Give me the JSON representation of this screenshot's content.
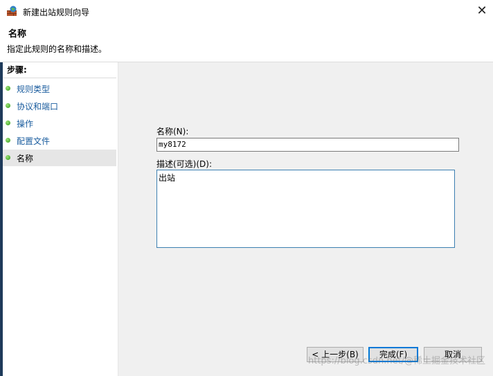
{
  "window": {
    "title": "新建出站规则向导",
    "close_glyph": "✕"
  },
  "header": {
    "title": "名称",
    "subtitle": "指定此规则的名称和描述。"
  },
  "sidebar": {
    "heading": "步骤:",
    "items": [
      {
        "label": "规则类型",
        "active": false
      },
      {
        "label": "协议和端口",
        "active": false
      },
      {
        "label": "操作",
        "active": false
      },
      {
        "label": "配置文件",
        "active": false
      },
      {
        "label": "名称",
        "active": true
      }
    ]
  },
  "form": {
    "name_label": "名称(N):",
    "name_value": "my8172",
    "desc_label": "描述(可选)(D):",
    "desc_value": "出站"
  },
  "buttons": {
    "back": "< 上一步(B)",
    "finish": "完成(F)",
    "cancel": "取消"
  },
  "watermark": "https://blog.csdn.net/@稀土掘金技术社区",
  "colors": {
    "accent": "#0078d7",
    "link": "#1a5c9e",
    "step_dot": "#2f9a16"
  }
}
